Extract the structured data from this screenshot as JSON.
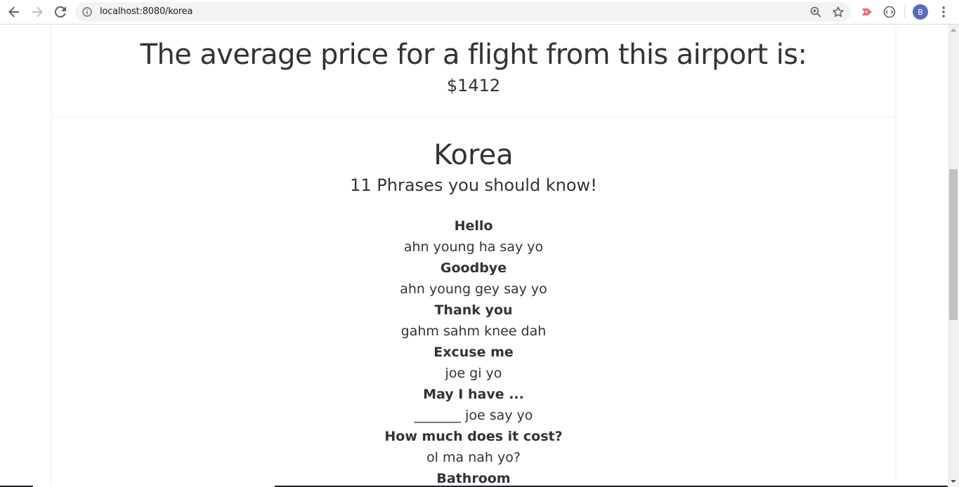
{
  "browser": {
    "url": "localhost:8080/korea",
    "avatar_letter": "B",
    "icons": {
      "back": "arrow-left-icon",
      "forward": "arrow-right-icon",
      "reload": "reload-icon",
      "info": "info-icon",
      "zoom": "zoom-icon",
      "bookmark": "star-icon",
      "extension_1": "cast-icon",
      "extension_2": "extension-icon",
      "menu": "kebab-menu-icon"
    },
    "colors": {
      "avatar": "#5c6bc0",
      "extension_1": "#f26b6b"
    }
  },
  "price": {
    "heading": "The average price for a flight from this airport is:",
    "value": "$1412"
  },
  "country": {
    "name": "Korea",
    "subtitle": "11 Phrases you should know!",
    "phrases": [
      {
        "en": "Hello",
        "ko": "ahn young ha say yo"
      },
      {
        "en": "Goodbye",
        "ko": "ahn young gey say yo"
      },
      {
        "en": "Thank you",
        "ko": "gahm sahm knee dah"
      },
      {
        "en": "Excuse me",
        "ko": "joe gi yo"
      },
      {
        "en": "May I have ...",
        "ko": "_______ joe say yo"
      },
      {
        "en": "How much does it cost?",
        "ko": "ol ma nah yo?"
      },
      {
        "en": "Bathroom",
        "ko": ""
      }
    ]
  }
}
